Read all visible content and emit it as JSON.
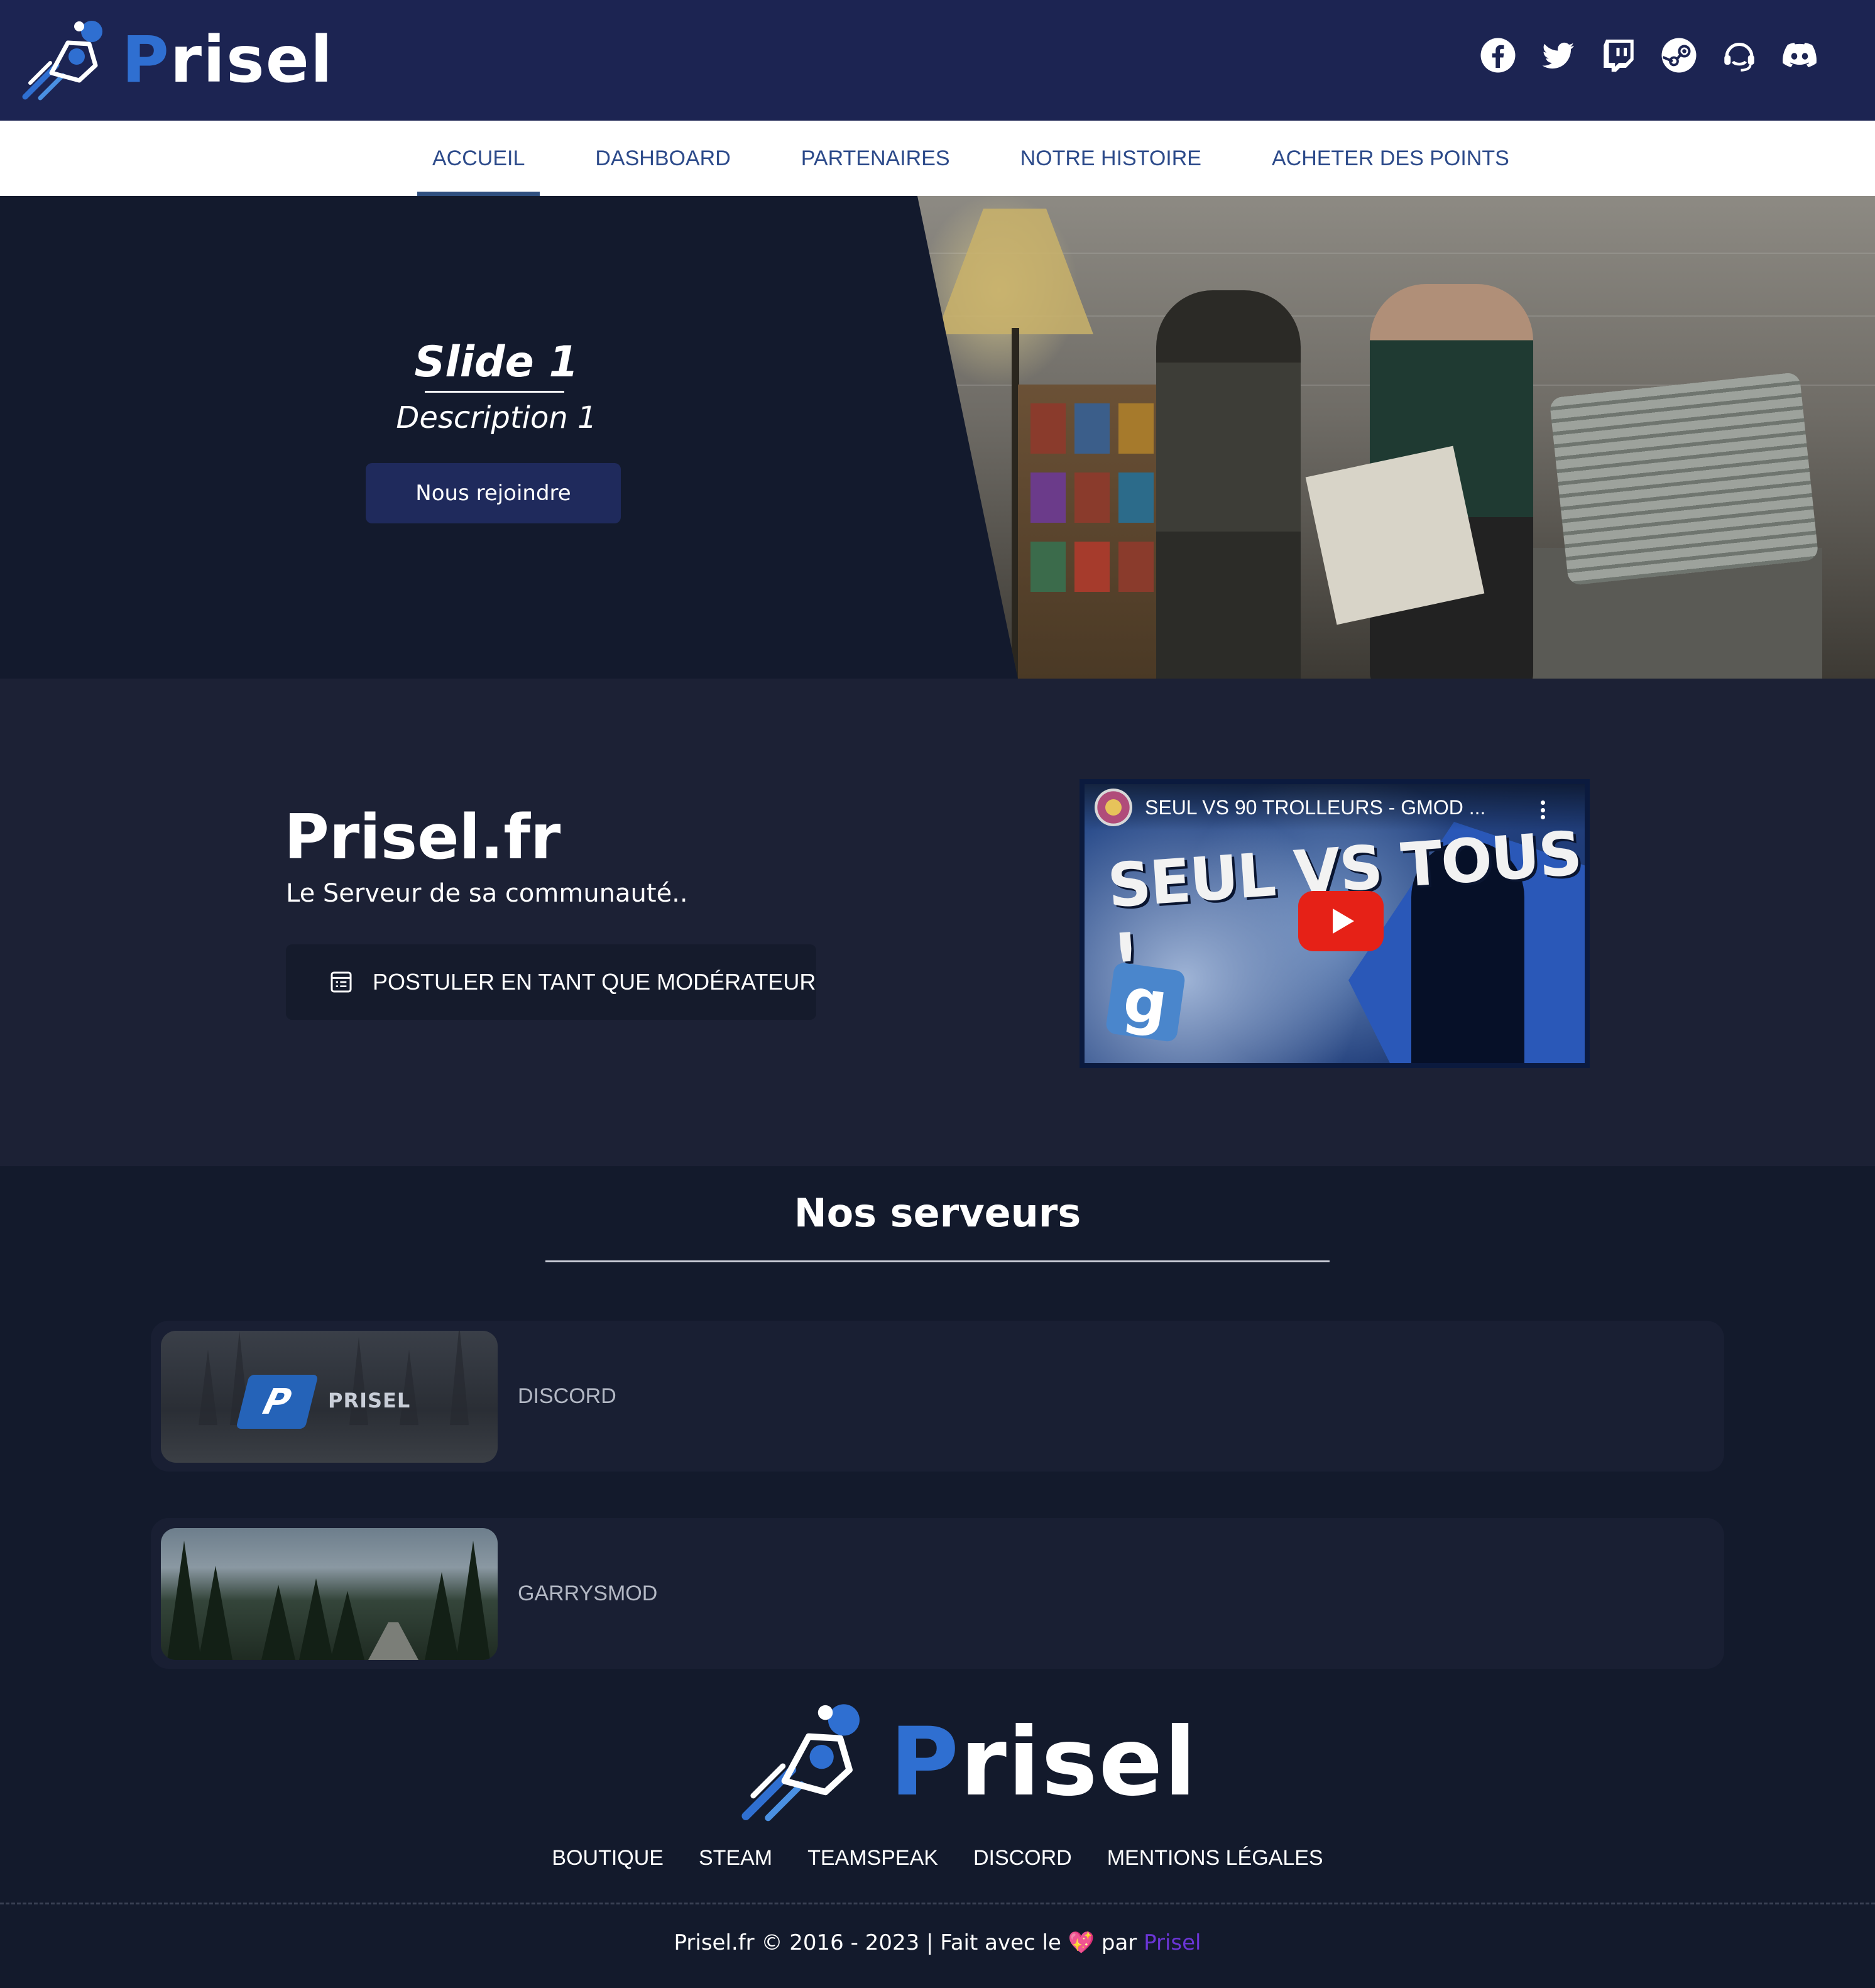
{
  "header": {
    "logo_text": "Prisel",
    "social_icons": [
      "facebook-icon",
      "twitter-icon",
      "twitch-icon",
      "steam-icon",
      "teamspeak-icon",
      "discord-icon"
    ]
  },
  "nav": {
    "items": [
      {
        "label": "ACCUEIL",
        "active": true
      },
      {
        "label": "DASHBOARD",
        "active": false
      },
      {
        "label": "PARTENAIRES",
        "active": false
      },
      {
        "label": "NOTRE HISTOIRE",
        "active": false
      },
      {
        "label": "ACHETER DES POINTS",
        "active": false
      }
    ]
  },
  "hero": {
    "title": "Slide 1",
    "description": "Description 1",
    "button_label": "Nous rejoindre"
  },
  "about": {
    "title": "Prisel.fr",
    "subtitle": "Le Serveur de sa communauté..",
    "apply_button_label": "POSTULER EN TANT QUE MODÉRATEUR",
    "video": {
      "caption": "SEUL VS 90 TROLLEURS - GMOD ...",
      "thumbnail_text": "SEUL VS TOUS !",
      "thumbnail_badge": "g"
    }
  },
  "servers": {
    "title": "Nos serveurs",
    "items": [
      {
        "name": "DISCORD",
        "thumb_text": "PRISEL"
      },
      {
        "name": "GARRYSMOD"
      }
    ]
  },
  "footer": {
    "logo_text": "Prisel",
    "links": [
      "BOUTIQUE",
      "STEAM",
      "TEAMSPEAK",
      "DISCORD",
      "MENTIONS LÉGALES"
    ],
    "copyright_prefix": "Prisel.fr © 2016 - 2023 | Fait avec le",
    "heart": "💖",
    "copyright_by": "par",
    "copyright_brand": "Prisel"
  },
  "colors": {
    "header_bg": "#1c2452",
    "accent_blue": "#2f6fd1",
    "nav_text": "#2c4a8a",
    "brand_purple": "#6b35d6"
  }
}
